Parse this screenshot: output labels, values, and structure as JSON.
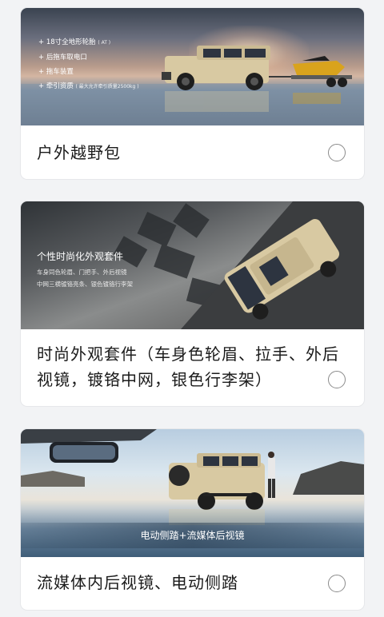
{
  "cards": [
    {
      "title": "户外越野包",
      "selected": false,
      "features": [
        {
          "text": "+ 18寸全地形轮胎",
          "note": "( AT )"
        },
        {
          "text": "+ 后拖车取电口",
          "note": ""
        },
        {
          "text": "+ 拖车装置",
          "note": ""
        },
        {
          "text": "+ 牵引资质",
          "note": "( 最大允许牵引质量2500kg )"
        }
      ]
    },
    {
      "title_line1": "时尚外观套件（车身色轮眉、拉手、外后",
      "title_line2": "视镜，镀铬中网，银色行李架）",
      "selected": false,
      "overlay_title": "个性时尚化外观套件",
      "overlay_line1": "车身同色轮眉、门把手、外后视镜",
      "overlay_line2": "中网三横镀铬亮条、银色镀铬行李架"
    },
    {
      "title": "流媒体内后视镜、电动侧踏",
      "selected": false,
      "banner": "电动侧踏+流媒体后视镜"
    }
  ],
  "colors": {
    "page_bg": "#f2f3f5",
    "card_bg": "#ffffff",
    "radio_border": "#8a8a8a",
    "vehicle": "#d8c9a2"
  }
}
